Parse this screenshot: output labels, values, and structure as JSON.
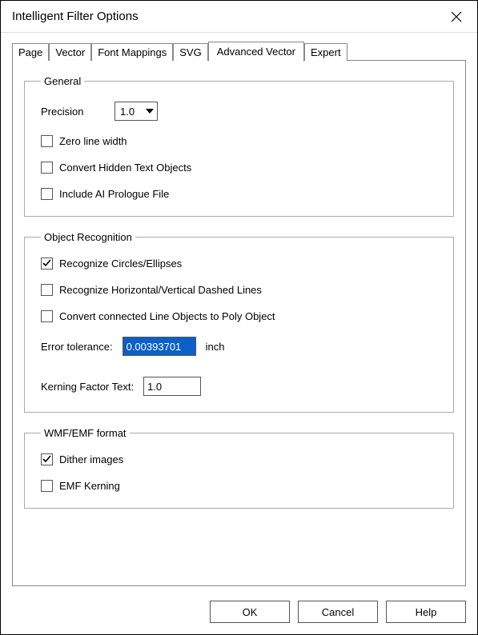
{
  "window": {
    "title": "Intelligent Filter Options"
  },
  "tabs": {
    "page": "Page",
    "vector": "Vector",
    "font_mappings": "Font Mappings",
    "svg": "SVG",
    "advanced_vector": "Advanced Vector",
    "expert": "Expert"
  },
  "general": {
    "legend": "General",
    "precision_label": "Precision",
    "precision_value": "1.0",
    "zero_line_width": "Zero line width",
    "convert_hidden": "Convert Hidden Text Objects",
    "include_ai": "Include AI Prologue File"
  },
  "object_recognition": {
    "legend": "Object Recognition",
    "recognize_circles": "Recognize Circles/Ellipses",
    "recognize_dashed": "Recognize Horizontal/Vertical Dashed Lines",
    "convert_poly": "Convert connected Line Objects to Poly Object",
    "error_tolerance_label": "Error tolerance:",
    "error_tolerance_value": "0.00393701",
    "error_tolerance_unit": "inch",
    "kerning_label": "Kerning Factor Text:",
    "kerning_value": "1.0"
  },
  "wmf_emf": {
    "legend": "WMF/EMF format",
    "dither": "Dither images",
    "emf_kerning": "EMF Kerning"
  },
  "buttons": {
    "ok": "OK",
    "cancel": "Cancel",
    "help": "Help"
  }
}
